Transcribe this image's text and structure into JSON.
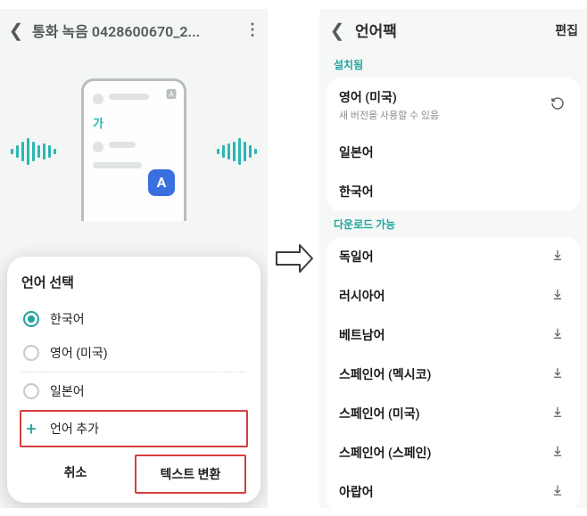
{
  "left": {
    "header": {
      "title": "통화 녹음 0428600670_2..."
    },
    "illustration": {
      "bubble_text": "가",
      "badge_letter": "A"
    },
    "dialog": {
      "title": "언어 선택",
      "options": [
        {
          "label": "한국어",
          "selected": true
        },
        {
          "label": "영어 (미국)",
          "selected": false
        },
        {
          "label": "일본어",
          "selected": false
        }
      ],
      "add_language_label": "언어 추가",
      "cancel_label": "취소",
      "confirm_label": "텍스트 변환"
    }
  },
  "right": {
    "header": {
      "title": "언어팩",
      "edit_label": "편집"
    },
    "installed_label": "설치됨",
    "installed": [
      {
        "label": "영어 (미국)",
        "sub": "새 버전을 사용할 수 있음",
        "action": "refresh"
      },
      {
        "label": "일본어",
        "sub": "",
        "action": ""
      },
      {
        "label": "한국어",
        "sub": "",
        "action": ""
      }
    ],
    "available_label": "다운로드 가능",
    "available": [
      {
        "label": "독일어"
      },
      {
        "label": "러시아어"
      },
      {
        "label": "베트남어"
      },
      {
        "label": "스페인어 (멕시코)"
      },
      {
        "label": "스페인어 (미국)"
      },
      {
        "label": "스페인어 (스페인)"
      },
      {
        "label": "아랍어"
      }
    ]
  }
}
